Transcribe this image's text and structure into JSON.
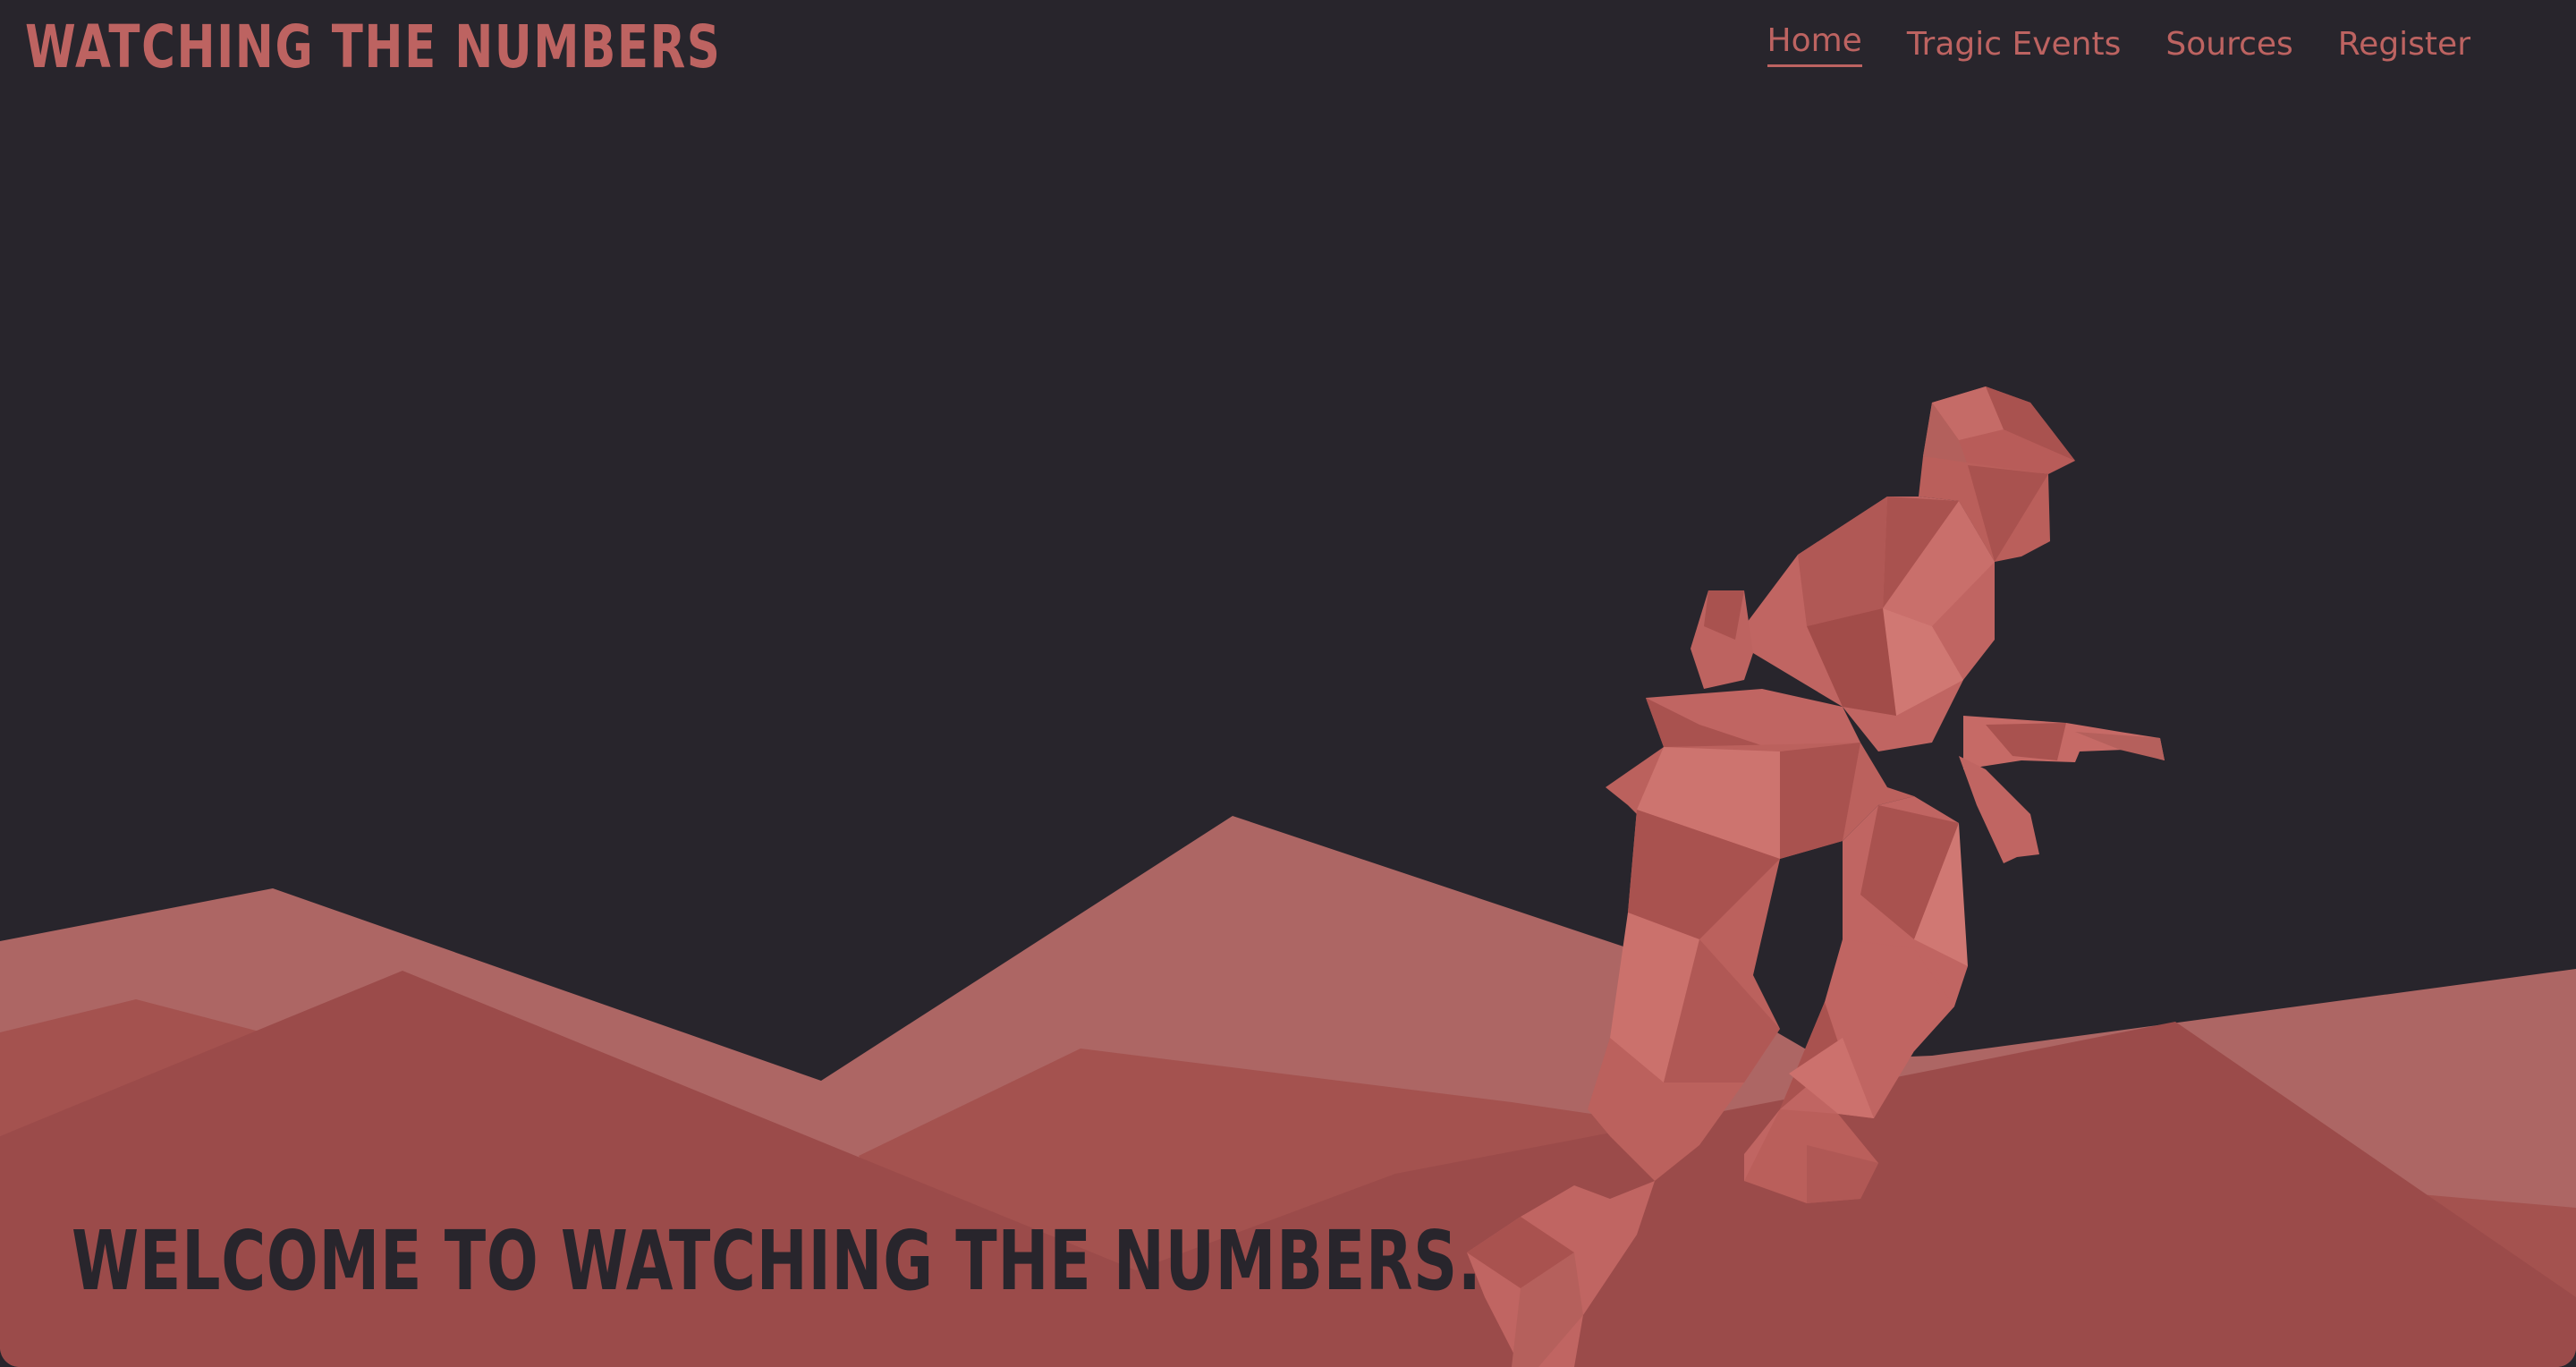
{
  "brand": {
    "title": "WATCHING THE NUMBERS"
  },
  "nav": {
    "items": [
      {
        "label": "Home",
        "active": true
      },
      {
        "label": "Tragic Events",
        "active": false
      },
      {
        "label": "Sources",
        "active": false
      },
      {
        "label": "Register",
        "active": false
      }
    ]
  },
  "hero": {
    "headline": "WELCOME TO WATCHING THE NUMBERS."
  },
  "colors": {
    "background": "#28252c",
    "accent": "#bd6361",
    "mountain_light": "#ad6664",
    "mountain_mid": "#a4524f",
    "mountain_dark": "#9b4b4a",
    "soldier_base": "#c0625f"
  },
  "icons": {
    "hero_illustration": "low-poly-soldier-running-over-mountains"
  }
}
